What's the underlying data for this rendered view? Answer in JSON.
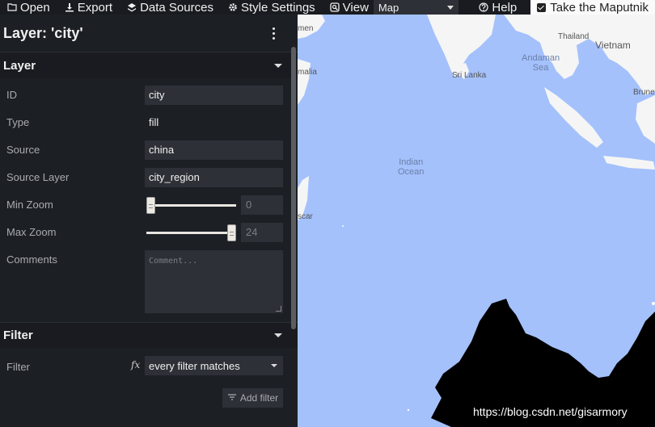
{
  "toolbar": {
    "open_label": "Open",
    "export_label": "Export",
    "data_sources_label": "Data Sources",
    "style_settings_label": "Style Settings",
    "view_label": "View",
    "view_select_value": "Map",
    "help_label": "Help",
    "tour_label": "Take the Maputnik"
  },
  "panel": {
    "title": "Layer: 'city'",
    "layer_section": {
      "heading": "Layer",
      "id_label": "ID",
      "id_value": "city",
      "type_label": "Type",
      "type_value": "fill",
      "source_label": "Source",
      "source_value": "china",
      "source_layer_label": "Source Layer",
      "source_layer_value": "city_region",
      "min_zoom_label": "Min Zoom",
      "min_zoom_value": "0",
      "max_zoom_label": "Max Zoom",
      "max_zoom_value": "24",
      "comments_label": "Comments",
      "comments_placeholder": "Comment..."
    },
    "filter_section": {
      "heading": "Filter",
      "filter_label": "Filter",
      "fx_symbol": "fx",
      "filter_select_value": "every filter matches",
      "add_filter_label": "Add filter"
    }
  },
  "map": {
    "labels": {
      "yemen_fragment": "men",
      "thailand": "Thailand",
      "vietnam": "Vietnam",
      "somalia_fragment": "malia",
      "andaman_sea": "Andaman\nSea",
      "sri_lanka": "Sri Lanka",
      "brunei_fragment": "Brunei",
      "indian_ocean": "Indian\nOcean",
      "madagascar_fragment": "scar"
    },
    "watermark": "https://blog.csdn.net/gisarmory"
  }
}
